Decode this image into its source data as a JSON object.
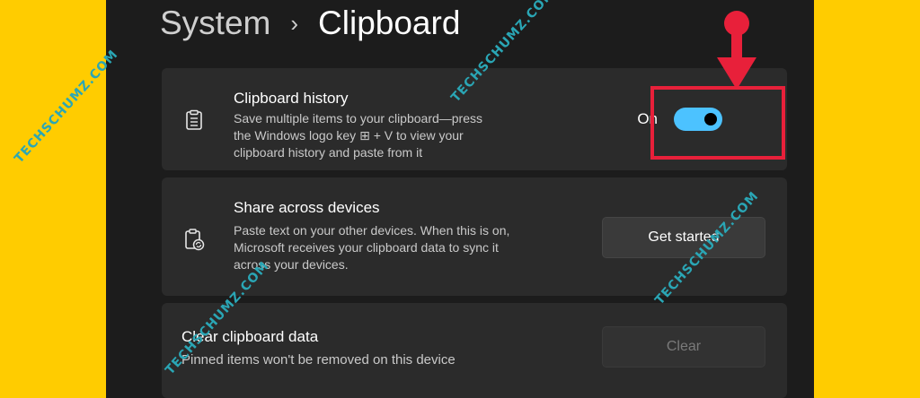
{
  "breadcrumb": {
    "parent": "System",
    "separator": "›",
    "current": "Clipboard"
  },
  "clipboard_history": {
    "title": "Clipboard history",
    "desc_1": "Save multiple items to your clipboard—press",
    "desc_2": "the Windows logo key ⊞ + V to view your",
    "desc_3": "clipboard history and paste from it",
    "state": "On",
    "icon": "clipboard-list-icon"
  },
  "share_devices": {
    "title": "Share across devices",
    "desc_1": "Paste text on your other devices. When this is on,",
    "desc_2": "Microsoft receives your clipboard data to sync it",
    "desc_3": "across your devices.",
    "button": "Get started",
    "icon": "clipboard-sync-icon"
  },
  "clear_data": {
    "title": "Clear clipboard data",
    "desc": "Pinned items won't be removed on this device",
    "button": "Clear"
  },
  "watermark": "TECHSCHUMZ.COM",
  "colors": {
    "accent": "#4cc2ff",
    "highlight": "#e8203a",
    "background": "#ffcc00",
    "watermark": "#2aa6b5"
  }
}
